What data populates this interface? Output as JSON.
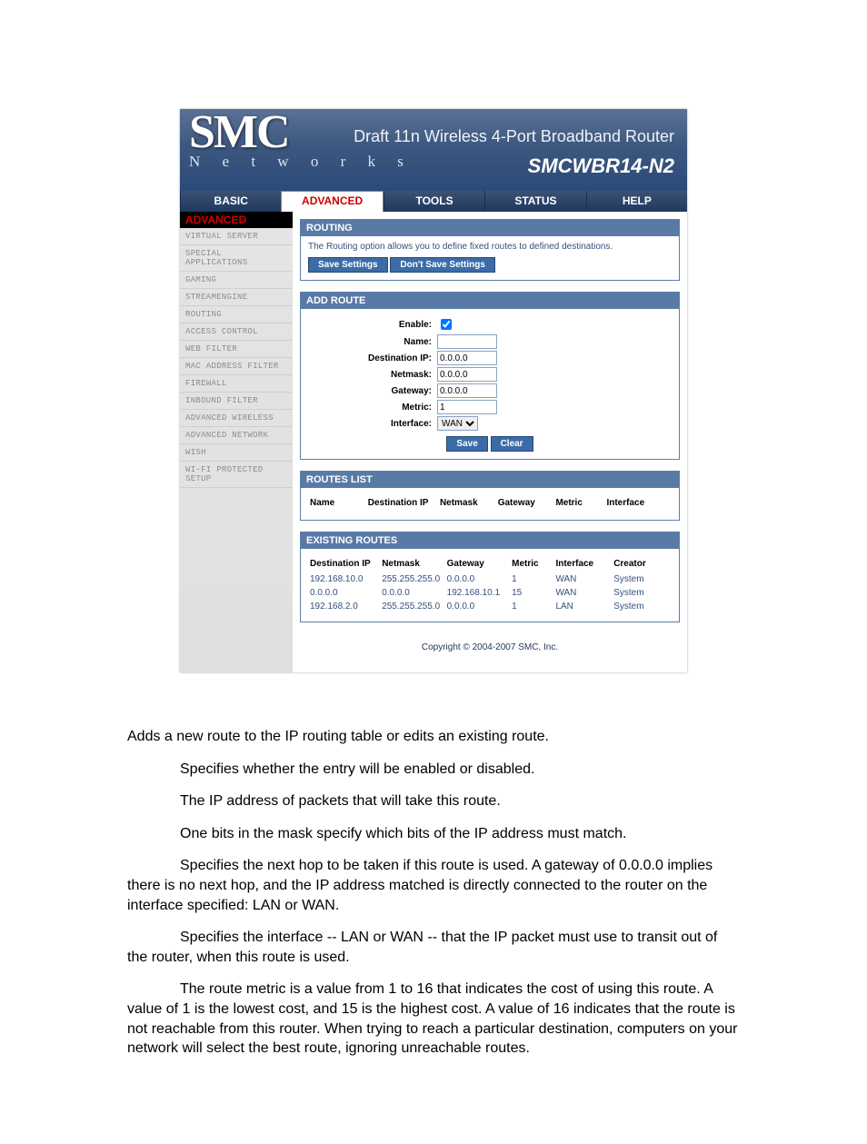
{
  "banner": {
    "logo": "SMC",
    "logo_sub": "N e t w o r k s",
    "title": "Draft 11n Wireless 4-Port Broadband Router",
    "model": "SMCWBR14-N2"
  },
  "topnav": {
    "items": [
      "BASIC",
      "ADVANCED",
      "TOOLS",
      "STATUS",
      "HELP"
    ]
  },
  "sidebar": {
    "heading": "ADVANCED",
    "items": [
      "VIRTUAL SERVER",
      "SPECIAL APPLICATIONS",
      "GAMING",
      "STREAMENGINE",
      "ROUTING",
      "ACCESS CONTROL",
      "WEB FILTER",
      "MAC ADDRESS FILTER",
      "FIREWALL",
      "INBOUND FILTER",
      "ADVANCED WIRELESS",
      "ADVANCED NETWORK",
      "WISH",
      "WI-FI PROTECTED SETUP"
    ]
  },
  "routing": {
    "title": "ROUTING",
    "desc": "The Routing option allows you to define fixed routes to defined destinations.",
    "save_btn": "Save Settings",
    "dontsave_btn": "Don't Save Settings"
  },
  "addroute": {
    "title": "ADD ROUTE",
    "labels": {
      "enable": "Enable:",
      "name": "Name:",
      "destip": "Destination IP:",
      "netmask": "Netmask:",
      "gateway": "Gateway:",
      "metric": "Metric:",
      "interface": "Interface:"
    },
    "values": {
      "destip": "0.0.0.0",
      "netmask": "0.0.0.0",
      "gateway": "0.0.0.0",
      "metric": "1",
      "interface": "WAN"
    },
    "save_btn": "Save",
    "clear_btn": "Clear"
  },
  "routeslist": {
    "title": "ROUTES LIST",
    "cols": [
      "Name",
      "Destination IP",
      "Netmask",
      "Gateway",
      "Metric",
      "Interface"
    ]
  },
  "existing": {
    "title": "EXISTING ROUTES",
    "cols": [
      "Destination IP",
      "Netmask",
      "Gateway",
      "Metric",
      "Interface",
      "Creator"
    ],
    "rows": [
      {
        "dest": "192.168.10.0",
        "mask": "255.255.255.0",
        "gw": "0.0.0.0",
        "metric": "1",
        "iface": "WAN",
        "creator": "System"
      },
      {
        "dest": "0.0.0.0",
        "mask": "0.0.0.0",
        "gw": "192.168.10.1",
        "metric": "15",
        "iface": "WAN",
        "creator": "System"
      },
      {
        "dest": "192.168.2.0",
        "mask": "255.255.255.0",
        "gw": "0.0.0.0",
        "metric": "1",
        "iface": "LAN",
        "creator": "System"
      }
    ]
  },
  "copyright": "Copyright © 2004-2007 SMC, Inc.",
  "doc": {
    "p1": "Adds a new route to the IP routing table or edits an existing route.",
    "p2": "Specifies whether the entry will be enabled or disabled.",
    "p3": "The IP address of packets that will take this route.",
    "p4": "One bits in the mask specify which bits of the IP address must match.",
    "p5": "Specifies the next hop to be taken if this route is used. A gateway of 0.0.0.0 implies there is no next hop, and the IP address matched is directly connected to the router on the interface specified: LAN or WAN.",
    "p6": "Specifies the interface -- LAN or WAN -- that the IP packet must use to transit out of the router, when this route is used.",
    "p7": "The route metric is a value from 1 to 16 that indicates the cost of using this route. A value of 1 is the lowest cost, and 15 is the highest cost. A value of 16 indicates that the route is not reachable from this router. When trying to reach a particular destination, computers on your network will select the best route, ignoring unreachable routes."
  }
}
